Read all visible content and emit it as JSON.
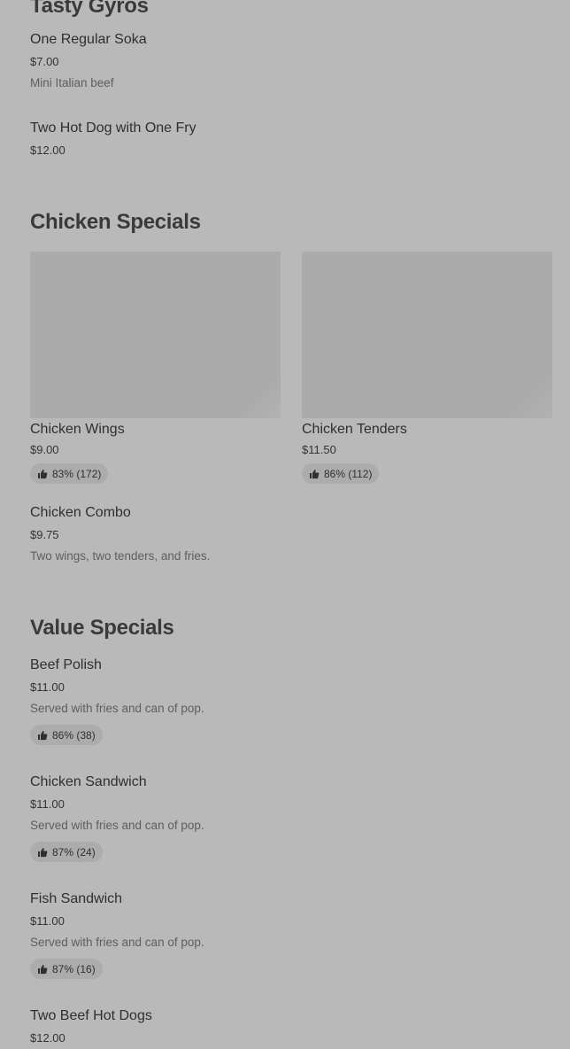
{
  "sections": {
    "tasty_gyros": {
      "title": "Tasty Gyros",
      "items": [
        {
          "name": "One Regular Soka",
          "price": "$7.00",
          "desc": "Mini Italian beef"
        },
        {
          "name": "Two Hot Dog with One Fry",
          "price": "$12.00"
        }
      ]
    },
    "chicken_specials": {
      "title": "Chicken Specials",
      "cards": [
        {
          "name": "Chicken Wings",
          "price": "$9.00",
          "rating": "83% (172)"
        },
        {
          "name": "Chicken Tenders",
          "price": "$11.50",
          "rating": "86% (112)"
        }
      ],
      "items": [
        {
          "name": "Chicken Combo",
          "price": "$9.75",
          "desc": "Two wings, two tenders, and fries."
        }
      ]
    },
    "value_specials": {
      "title": "Value Specials",
      "items": [
        {
          "name": "Beef Polish",
          "price": "$11.00",
          "desc": "Served with fries and can of pop.",
          "rating": "86% (38)"
        },
        {
          "name": "Chicken Sandwich",
          "price": "$11.00",
          "desc": "Served with fries and can of pop.",
          "rating": "87% (24)"
        },
        {
          "name": "Fish Sandwich",
          "price": "$11.00",
          "desc": "Served with fries and can of pop.",
          "rating": "87% (16)"
        },
        {
          "name": "Two Beef Hot Dogs",
          "price": "$12.00"
        }
      ]
    }
  },
  "icons": {
    "rating": "thumbs-up-icon"
  },
  "colors": {
    "background": "#b9b9b9",
    "pill": "#acacac",
    "image_placeholder": "#ababab"
  }
}
